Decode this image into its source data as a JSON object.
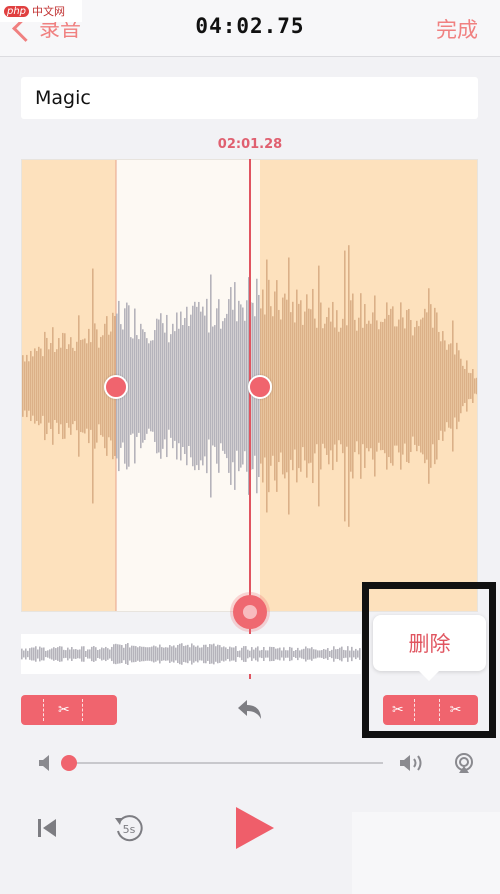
{
  "watermark": {
    "logo": "php",
    "text": "中文网"
  },
  "nav": {
    "back_label": "录音",
    "title": "04:02.75",
    "done_label": "完成"
  },
  "recording": {
    "name": "Magic"
  },
  "playhead": {
    "time": "02:01.28",
    "position": 0.5
  },
  "trim": {
    "start_fraction": 0.2,
    "end_fraction": 0.5
  },
  "popup": {
    "delete_label": "删除"
  },
  "buttons": {
    "skip_back_label": "5s"
  },
  "volume": {
    "level": 0.02
  },
  "colors": {
    "accent": "#f0646e",
    "selected_region": "#fde1bd",
    "waveform_gray": "#b5b3bb",
    "waveform_tan": "#dbb088"
  },
  "icons": [
    "chevron-left-icon",
    "scissors-icon",
    "undo-icon",
    "speaker-low-icon",
    "speaker-high-icon",
    "airplay-icon",
    "skip-to-start-icon",
    "rewind-5s-icon",
    "play-icon"
  ]
}
